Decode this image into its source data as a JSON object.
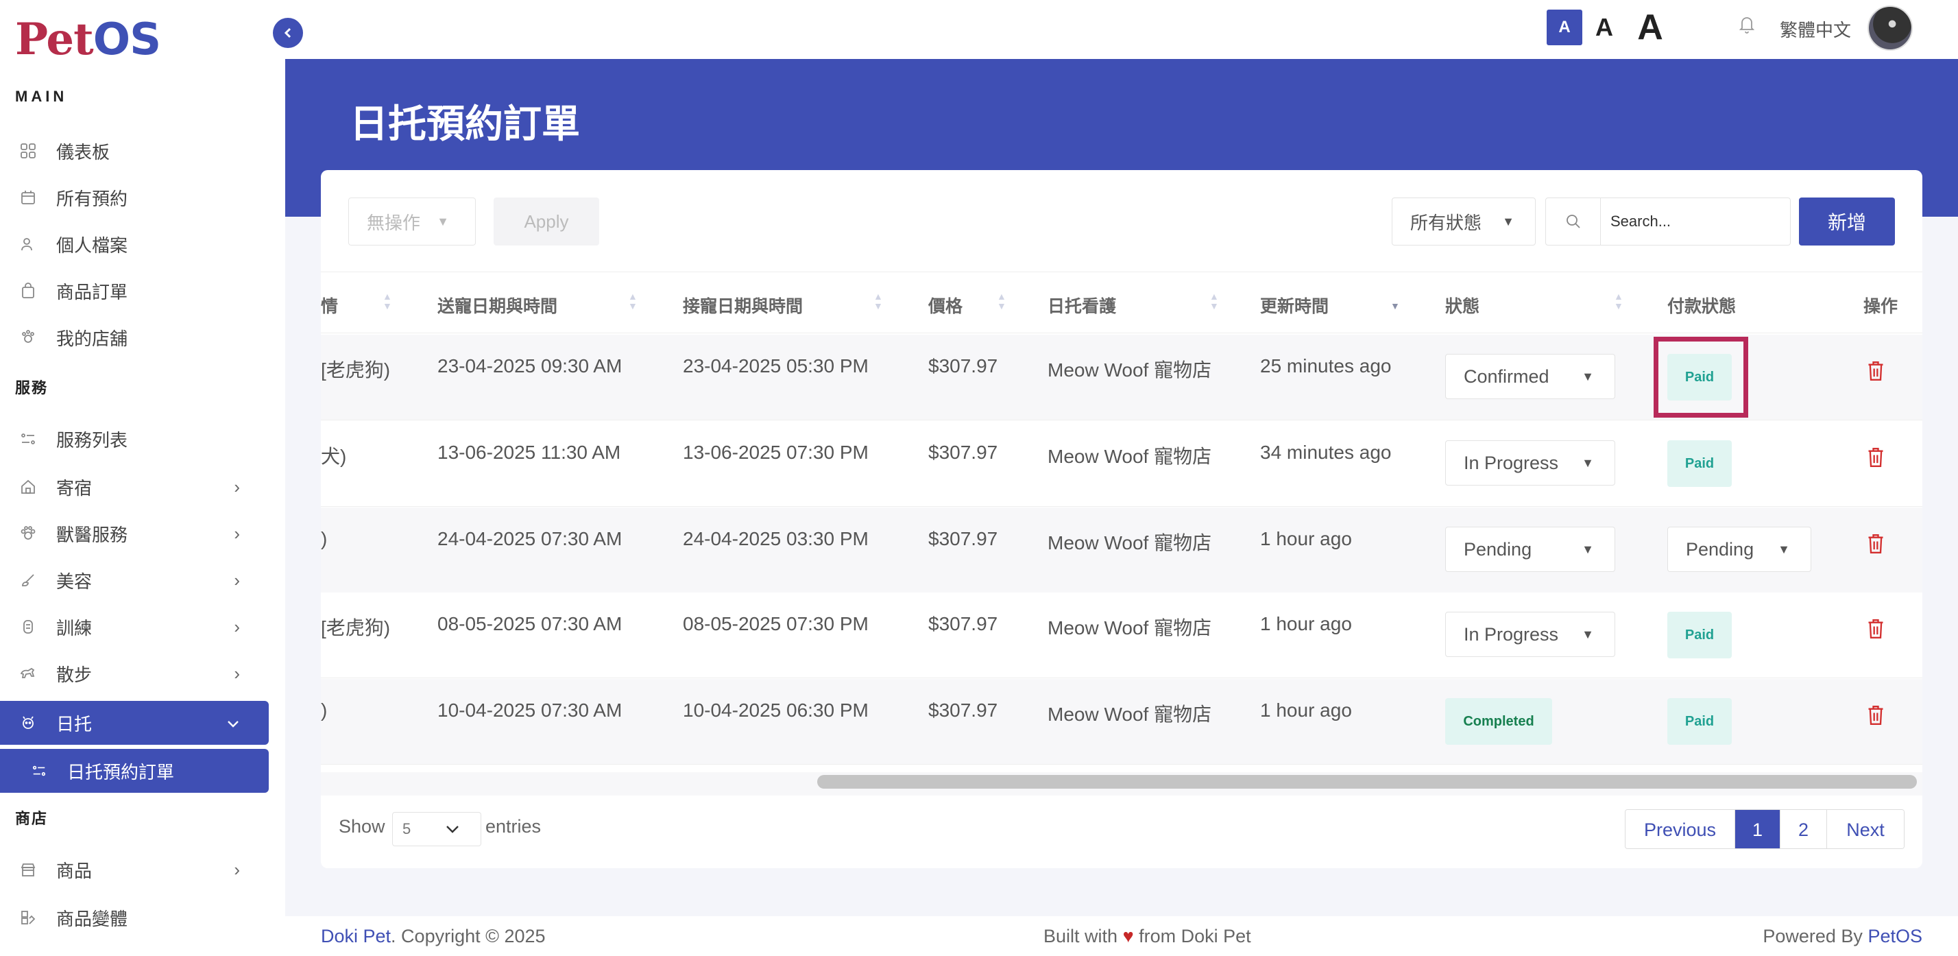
{
  "app": {
    "logo_pet": "Pet",
    "logo_os": "OS"
  },
  "sidebar": {
    "sections": {
      "main": "MAIN",
      "services": "服務",
      "shop": "商店"
    },
    "items": [
      {
        "label": "儀表板",
        "icon": "grid-icon"
      },
      {
        "label": "所有預約",
        "icon": "calendar-icon"
      },
      {
        "label": "個人檔案",
        "icon": "user-icon"
      },
      {
        "label": "商品訂單",
        "icon": "bag-icon"
      },
      {
        "label": "我的店舖",
        "icon": "store-icon"
      },
      {
        "label": "服務列表",
        "icon": "list-icon"
      },
      {
        "label": "寄宿",
        "icon": "house-icon"
      },
      {
        "label": "獸醫服務",
        "icon": "vet-icon"
      },
      {
        "label": "美容",
        "icon": "brush-icon"
      },
      {
        "label": "訓練",
        "icon": "training-icon"
      },
      {
        "label": "散步",
        "icon": "walk-icon"
      },
      {
        "label": "日托",
        "icon": "daycare-icon"
      },
      {
        "label": "日托預約訂單",
        "icon": "list-icon"
      },
      {
        "label": "商品",
        "icon": "shop-icon"
      },
      {
        "label": "商品變體",
        "icon": "variant-icon"
      }
    ],
    "chevron_right": "›",
    "chevron_down": "⌄"
  },
  "topbar": {
    "font_small": "A",
    "font_medium": "A",
    "font_large": "A",
    "language": "繁體中文"
  },
  "page": {
    "title": "日托預約訂單"
  },
  "toolbar": {
    "bulk_action": "無操作",
    "apply": "Apply",
    "status_filter": "所有狀態",
    "search_placeholder": "Search...",
    "add": "新增"
  },
  "table": {
    "headers": [
      "情",
      "送寵日期與時間",
      "接寵日期與時間",
      "價格",
      "日托看護",
      "更新時間",
      "狀態",
      "付款狀態",
      "操作"
    ],
    "rows": [
      {
        "pet": "[老虎狗)",
        "dropoff": "23-04-2025 09:30 AM",
        "pickup": "23-04-2025 05:30 PM",
        "price": "$307.97",
        "caretaker": "Meow Woof 寵物店",
        "updated": "25 minutes ago",
        "status": "Confirmed",
        "status_type": "select",
        "payment": "Paid",
        "payment_type": "badge"
      },
      {
        "pet": "犬)",
        "dropoff": "13-06-2025 11:30 AM",
        "pickup": "13-06-2025 07:30 PM",
        "price": "$307.97",
        "caretaker": "Meow Woof 寵物店",
        "updated": "34 minutes ago",
        "status": "In Progress",
        "status_type": "select",
        "payment": "Paid",
        "payment_type": "badge"
      },
      {
        "pet": ")",
        "dropoff": "24-04-2025 07:30 AM",
        "pickup": "24-04-2025 03:30 PM",
        "price": "$307.97",
        "caretaker": "Meow Woof 寵物店",
        "updated": "1 hour ago",
        "status": "Pending",
        "status_type": "select",
        "payment": "Pending",
        "payment_type": "select"
      },
      {
        "pet": "[老虎狗)",
        "dropoff": "08-05-2025 07:30 AM",
        "pickup": "08-05-2025 07:30 PM",
        "price": "$307.97",
        "caretaker": "Meow Woof 寵物店",
        "updated": "1 hour ago",
        "status": "In Progress",
        "status_type": "select",
        "payment": "Paid",
        "payment_type": "badge"
      },
      {
        "pet": ")",
        "dropoff": "10-04-2025 07:30 AM",
        "pickup": "10-04-2025 06:30 PM",
        "price": "$307.97",
        "caretaker": "Meow Woof 寵物店",
        "updated": "1 hour ago",
        "status": "Completed",
        "status_type": "badge",
        "payment": "Paid",
        "payment_type": "badge"
      }
    ]
  },
  "pagination": {
    "show": "Show",
    "length": "5",
    "entries": "entries",
    "previous": "Previous",
    "pages": [
      "1",
      "2"
    ],
    "next": "Next"
  },
  "footer": {
    "brand": "Doki Pet",
    "copyright": ". Copyright © 2025",
    "built_prefix": "Built with",
    "heart": "♥",
    "built_suffix": "from Doki Pet",
    "powered_prefix": "Powered By",
    "powered_brand": "PetOS"
  },
  "colors": {
    "primary": "#3f4fb4",
    "brand_red": "#b52d4a",
    "badge_bg": "#e1f5f2",
    "badge_text": "#20a192",
    "delete": "#d32f2f",
    "highlight": "#b82a5a"
  }
}
